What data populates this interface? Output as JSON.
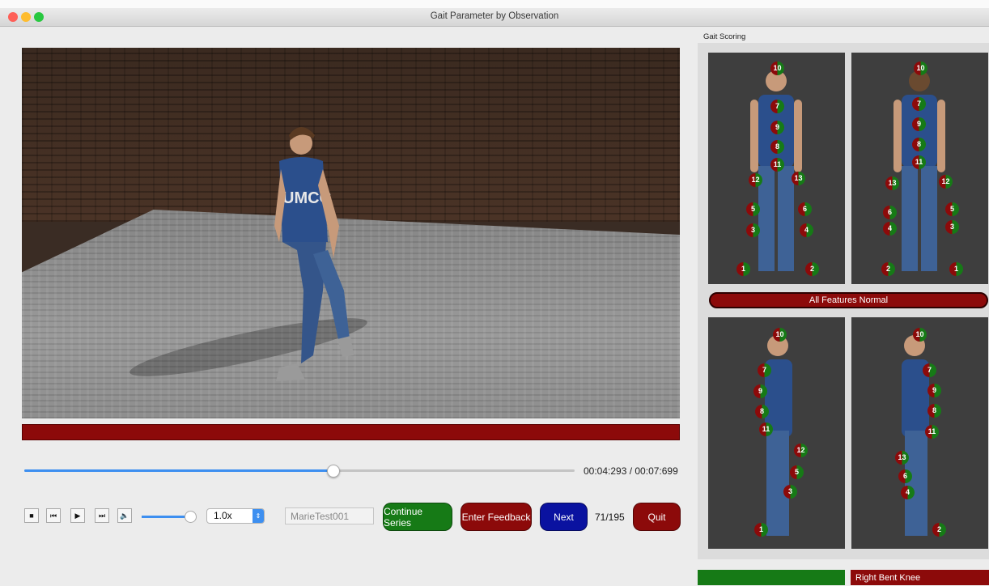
{
  "window": {
    "title": "Gait Parameter by Observation",
    "traffic_colors": [
      "#fe5f57",
      "#febc2e",
      "#28c840"
    ]
  },
  "player": {
    "progress_fraction": 0.56,
    "time_display": "00:04:293 / 00:07:699",
    "volume_fraction": 0.95,
    "speed": "1.0x",
    "controls": [
      "stop-icon",
      "skip-back-icon",
      "play-icon",
      "skip-forward-icon",
      "volume-icon"
    ]
  },
  "form": {
    "test_id": "MarieTest001"
  },
  "buttons": {
    "continue_series": "Continue Series",
    "enter_feedback": "Enter  Feedback",
    "next": "Next",
    "quit": "Quit"
  },
  "counter": "71/195",
  "scoring": {
    "label": "Gait Scoring",
    "all_normal_label": "All Features Normal",
    "bottom_right_label": "Right Bent Knee"
  },
  "colors": {
    "red": "#8c0a0a",
    "green": "#167a16",
    "blue": "#0a12a0",
    "accent": "#3d8ff0"
  },
  "views": {
    "front": [
      "10",
      "7",
      "9",
      "8",
      "11",
      "12",
      "13",
      "5",
      "6",
      "3",
      "4",
      "1",
      "2"
    ],
    "back": [
      "10",
      "7",
      "9",
      "8",
      "11",
      "13",
      "12",
      "6",
      "5",
      "4",
      "3",
      "2",
      "1"
    ],
    "left": [
      "10",
      "7",
      "9",
      "8",
      "11",
      "12",
      "5",
      "3",
      "1"
    ],
    "right": [
      "10",
      "7",
      "9",
      "8",
      "11",
      "13",
      "6",
      "4",
      "2"
    ]
  }
}
